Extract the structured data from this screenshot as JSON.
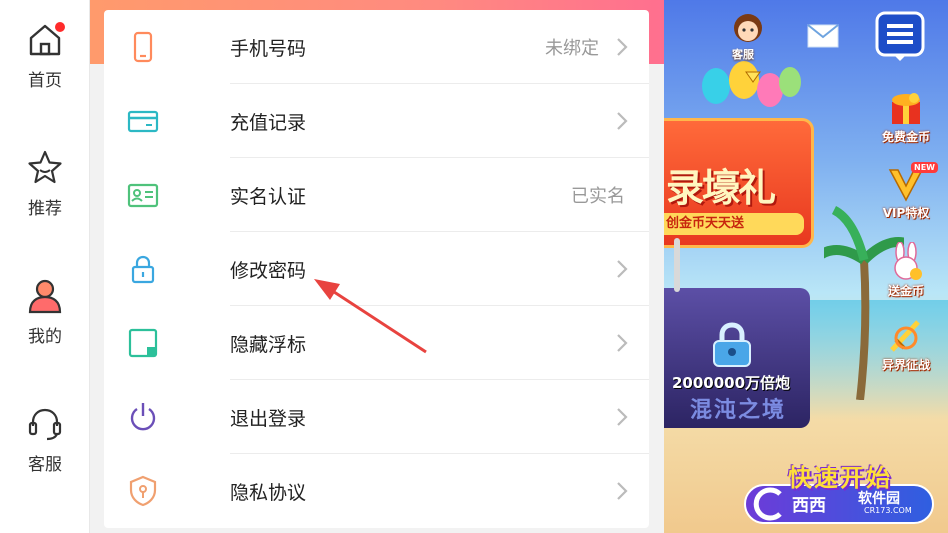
{
  "nav": {
    "items": [
      {
        "label": "首页",
        "icon": "home-icon",
        "badge": true
      },
      {
        "label": "推荐",
        "icon": "star-icon"
      },
      {
        "label": "我的",
        "icon": "user-icon"
      },
      {
        "label": "客服",
        "icon": "headset-icon"
      }
    ]
  },
  "settings": {
    "rows": [
      {
        "label": "手机号码",
        "value": "未绑定",
        "icon": "phone-icon",
        "chevron": true
      },
      {
        "label": "充值记录",
        "value": "",
        "icon": "card-icon",
        "chevron": true
      },
      {
        "label": "实名认证",
        "value": "已实名",
        "icon": "id-card-icon",
        "chevron": false
      },
      {
        "label": "修改密码",
        "value": "",
        "icon": "lock-icon",
        "chevron": true
      },
      {
        "label": "隐藏浮标",
        "value": "",
        "icon": "hide-float-icon",
        "chevron": true
      },
      {
        "label": "退出登录",
        "value": "",
        "icon": "power-icon",
        "chevron": true
      },
      {
        "label": "隐私协议",
        "value": "",
        "icon": "shield-icon",
        "chevron": true
      }
    ]
  },
  "game": {
    "cs_label": "客服",
    "banner1_big": "录壕礼",
    "banner1_small": "创金币天天送",
    "banner2_amount": "2000000万倍炮",
    "banner2_sub": "混沌之境",
    "side": [
      {
        "label": "免费金币",
        "icon": "gift-icon"
      },
      {
        "label": "VIP特权",
        "icon": "vip-icon",
        "badge": "NEW"
      },
      {
        "label": "送金币",
        "icon": "rabbit-icon"
      },
      {
        "label": "异界征战",
        "icon": "sword-icon"
      }
    ],
    "quick_start": "快速开始",
    "watermark_a": "西西",
    "watermark_b": "软件园",
    "watermark_c": "CR173.COM"
  },
  "colors": {
    "accent_gradient": [
      "#ff9a6c",
      "#ff6f8f"
    ],
    "annotation_arrow": "#e8433f",
    "lock_blue": "#4aa6e8"
  }
}
